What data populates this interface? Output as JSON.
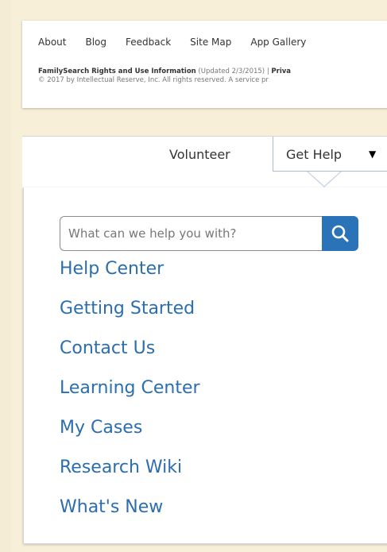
{
  "footer": {
    "links": [
      "About",
      "Blog",
      "Feedback",
      "Site Map",
      "App Gallery"
    ],
    "rights_title": "FamilySearch Rights and Use Information",
    "rights_updated": " (Updated 2/3/2015) | ",
    "rights_privacy": "Priva",
    "copyright": "© 2017 by Intellectual Reserve, Inc. All rights reserved. A service pr"
  },
  "header": {
    "volunteer_label": "Volunteer",
    "get_help_label": "Get Help",
    "caret": "▼"
  },
  "search": {
    "placeholder": "What can we help you with?"
  },
  "menu": {
    "items": [
      {
        "label": "Help Center"
      },
      {
        "label": "Getting Started"
      },
      {
        "label": "Contact Us"
      },
      {
        "label": "Learning Center"
      },
      {
        "label": "My Cases"
      },
      {
        "label": "Research Wiki"
      },
      {
        "label": "What's New"
      }
    ]
  },
  "colors": {
    "page_background": "#f8efd9",
    "link_blue": "#2a6db0",
    "search_button": "#2a73b8"
  },
  "icons": {
    "search_button_icon": "search-icon",
    "dropdown_caret": "caret-down-icon"
  }
}
